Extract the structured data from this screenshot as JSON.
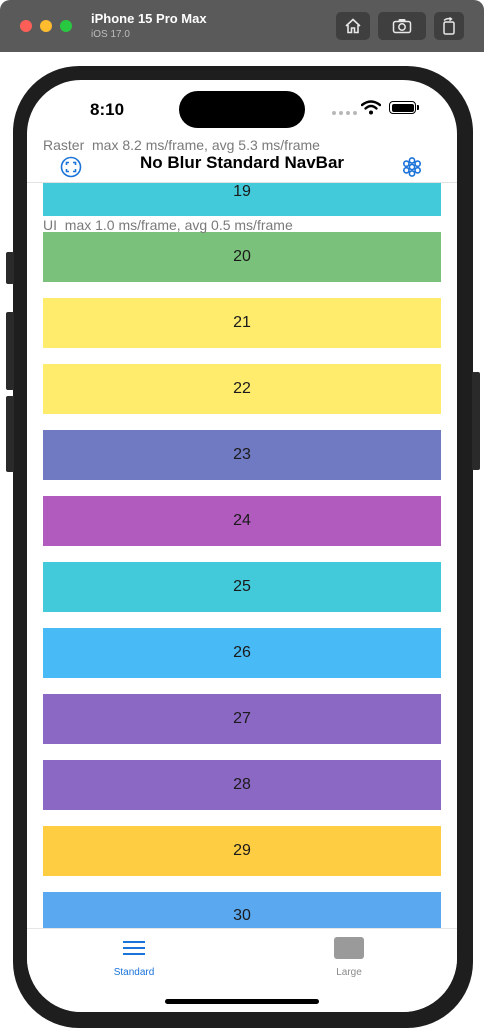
{
  "simulator": {
    "device_name": "iPhone 15 Pro Max",
    "os_version": "iOS 17.0",
    "toolbar_icons": [
      "home-icon",
      "screenshot-icon",
      "rotate-icon"
    ]
  },
  "status_bar": {
    "time": "8:10",
    "icons": [
      "cellular-icon",
      "wifi-icon",
      "battery-icon"
    ]
  },
  "perf": {
    "raster": "Raster  max 8.2 ms/frame, avg 5.3 ms/frame",
    "ui": "UI  max 1.0 ms/frame, avg 0.5 ms/frame"
  },
  "navbar": {
    "title": "No Blur Standard NavBar",
    "left_icon": "fullscreen-icon",
    "right_icon": "flower-icon"
  },
  "list": {
    "items": [
      {
        "label": "19",
        "color": "#42cada"
      },
      {
        "label": "20",
        "color": "#7ac27b"
      },
      {
        "label": "21",
        "color": "#ffec6d"
      },
      {
        "label": "22",
        "color": "#ffec6d"
      },
      {
        "label": "23",
        "color": "#707ac2"
      },
      {
        "label": "24",
        "color": "#b05bbd"
      },
      {
        "label": "25",
        "color": "#42cada"
      },
      {
        "label": "26",
        "color": "#48baf5"
      },
      {
        "label": "27",
        "color": "#8b68c4"
      },
      {
        "label": "28",
        "color": "#8b68c4"
      },
      {
        "label": "29",
        "color": "#ffcd42"
      },
      {
        "label": "30",
        "color": "#5aa9f0"
      }
    ]
  },
  "tabbar": {
    "tabs": [
      {
        "label": "Standard",
        "icon": "menu-icon",
        "selected": true
      },
      {
        "label": "Large",
        "icon": "square-icon",
        "selected": false
      }
    ]
  },
  "colors": {
    "accent": "#1a73d9",
    "simulator_bar": "#5a5a5a"
  }
}
